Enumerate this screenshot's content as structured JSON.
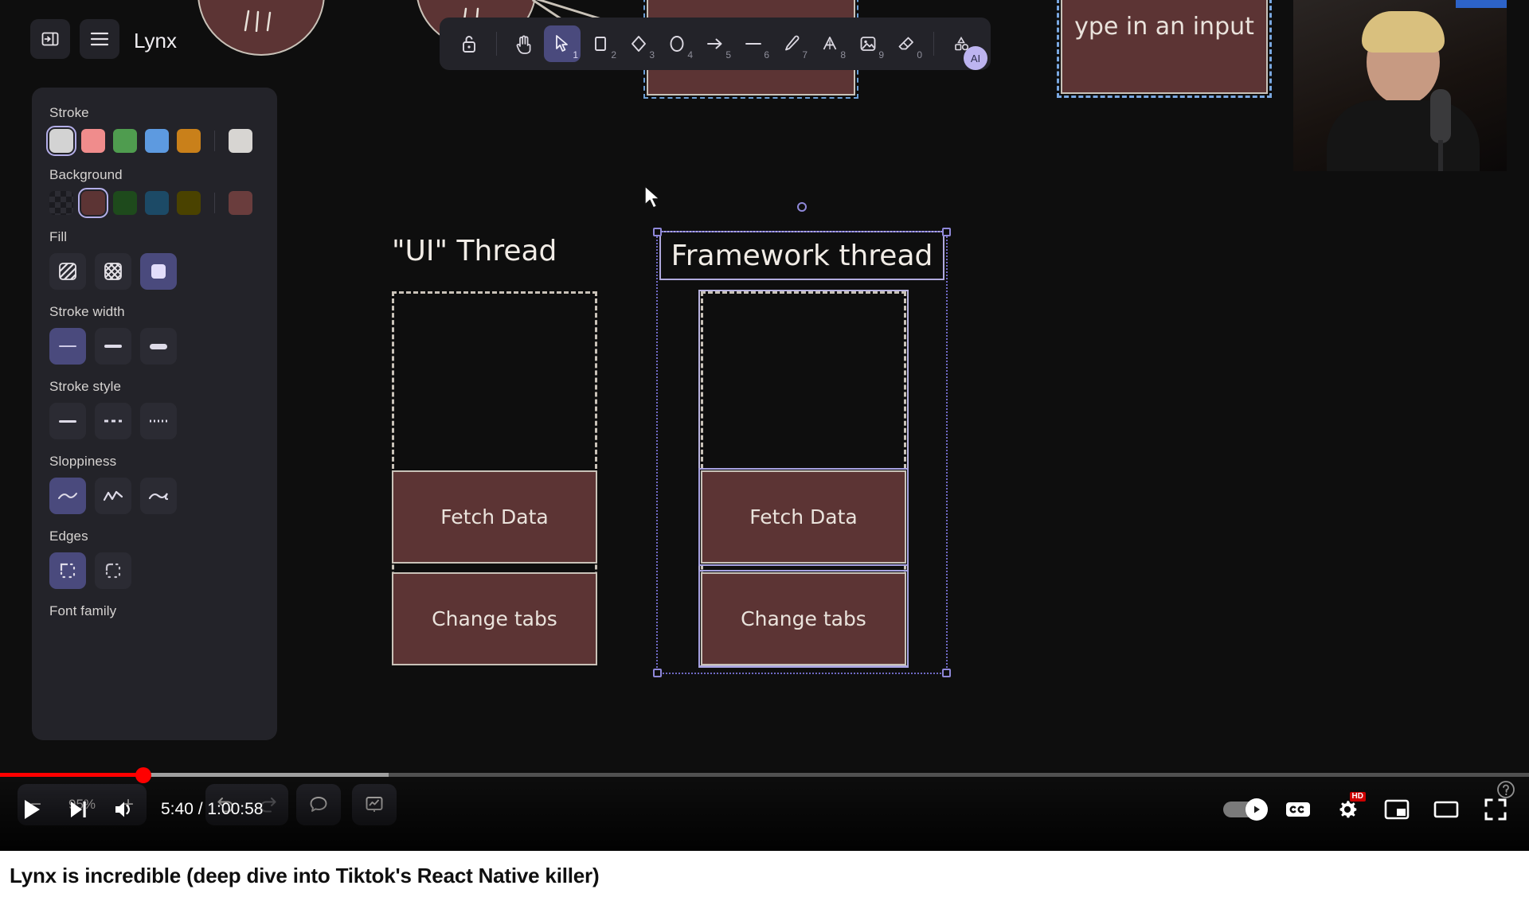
{
  "app": {
    "name": "Lynx",
    "sidebar_toggle_label": "toggle-sidebar",
    "menu_label": "main-menu"
  },
  "panel": {
    "sections": [
      {
        "label": "Stroke",
        "type": "color",
        "swatches": [
          "#d3d3d3",
          "#f08c8c",
          "#4f9c4f",
          "#5d9ae0",
          "#c9801a"
        ],
        "selected_index": 0,
        "current": "#d3d3d3"
      },
      {
        "label": "Background",
        "type": "color",
        "swatches": [
          "transparent",
          "#5c3434",
          "#1e4a1c",
          "#1c4a66",
          "#4a4200"
        ],
        "selected_index": 1,
        "current": "#5c3434"
      },
      {
        "label": "Fill",
        "type": "options",
        "options": [
          "hachure",
          "cross-hatch",
          "solid"
        ],
        "selected_index": 2
      },
      {
        "label": "Stroke width",
        "type": "options",
        "options": [
          "thin",
          "bold",
          "extra-bold"
        ],
        "selected_index": 0
      },
      {
        "label": "Stroke style",
        "type": "options",
        "options": [
          "solid",
          "dashed",
          "dotted"
        ],
        "selected_index": -1
      },
      {
        "label": "Sloppiness",
        "type": "options",
        "options": [
          "architect",
          "artist",
          "cartoonist"
        ],
        "selected_index": 0
      },
      {
        "label": "Edges",
        "type": "options",
        "options": [
          "sharp",
          "round"
        ],
        "selected_index": 0
      },
      {
        "label": "Font family",
        "type": "options",
        "options": [],
        "selected_index": -1
      }
    ]
  },
  "toolbar": {
    "lock_label": "lock",
    "tools": [
      {
        "name": "hand",
        "key": "",
        "active": false
      },
      {
        "name": "selection",
        "key": "1",
        "active": true
      },
      {
        "name": "rectangle",
        "key": "2",
        "active": false
      },
      {
        "name": "diamond",
        "key": "3",
        "active": false
      },
      {
        "name": "ellipse",
        "key": "4",
        "active": false
      },
      {
        "name": "arrow",
        "key": "5",
        "active": false
      },
      {
        "name": "line",
        "key": "6",
        "active": false
      },
      {
        "name": "draw",
        "key": "7",
        "active": false
      },
      {
        "name": "text",
        "key": "8",
        "active": false
      },
      {
        "name": "image",
        "key": "9",
        "active": false
      },
      {
        "name": "eraser",
        "key": "0",
        "active": false
      }
    ],
    "ai_label": "AI",
    "frame_label": "shapes"
  },
  "footer": {
    "zoom_out": "−",
    "zoom_level": "95%",
    "zoom_in": "+",
    "undo": "undo",
    "redo": "redo",
    "chat": "chat",
    "present": "present"
  },
  "canvas": {
    "ui_thread_label": "\"UI\" Thread",
    "framework_thread_label": "Framework thread",
    "ui_boxes": [
      "Fetch Data",
      "Change tabs"
    ],
    "framework_boxes": [
      "Fetch Data",
      "Change tabs"
    ],
    "input_box_label": "ype in an input",
    "selection_accent": "#8f88d9",
    "box_fill": "#5c3434",
    "box_stroke": "#c9c2b8"
  },
  "player": {
    "play_label": "play",
    "next_label": "next-video",
    "volume_label": "volume",
    "current_time": "5:40",
    "duration": "1:00:58",
    "time_display": "5:40 / 1:00:58",
    "autoplay_label": "autoplay",
    "captions_label": "CC",
    "settings_label": "settings",
    "quality_badge": "HD",
    "miniplayer_label": "miniplayer",
    "theater_label": "theater-mode",
    "fullscreen_label": "fullscreen",
    "help_label": "help",
    "progress_played_percent": 9.35,
    "progress_loaded_percent": 25.4,
    "progress_color": "#ff0000"
  },
  "video": {
    "title": "Lynx is incredible (deep dive into Tiktok's React Native killer)"
  }
}
